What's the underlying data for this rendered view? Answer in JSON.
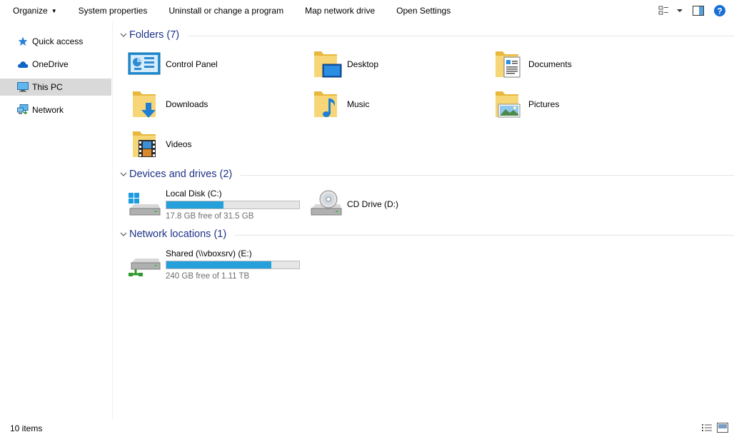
{
  "toolbar": {
    "organize": "Organize",
    "system_properties": "System properties",
    "uninstall": "Uninstall or change a program",
    "map_drive": "Map network drive",
    "open_settings": "Open Settings"
  },
  "nav": {
    "items": [
      {
        "label": "Quick access",
        "icon": "star-icon"
      },
      {
        "label": "OneDrive",
        "icon": "cloud-icon"
      },
      {
        "label": "This PC",
        "icon": "computer-icon",
        "selected": true
      },
      {
        "label": "Network",
        "icon": "network-icon"
      }
    ]
  },
  "groups": {
    "folders": {
      "title": "Folders (7)",
      "items": [
        {
          "label": "Control Panel",
          "icon": "control-panel-icon"
        },
        {
          "label": "Desktop",
          "icon": "desktop-folder-icon"
        },
        {
          "label": "Documents",
          "icon": "documents-folder-icon"
        },
        {
          "label": "Downloads",
          "icon": "downloads-folder-icon"
        },
        {
          "label": "Music",
          "icon": "music-folder-icon"
        },
        {
          "label": "Pictures",
          "icon": "pictures-folder-icon"
        },
        {
          "label": "Videos",
          "icon": "videos-folder-icon"
        }
      ]
    },
    "devices": {
      "title": "Devices and drives (2)",
      "items": [
        {
          "label": "Local Disk (C:)",
          "free": "17.8 GB free of 31.5 GB",
          "used_fraction": 0.43,
          "icon": "local-disk-icon"
        },
        {
          "label": "CD Drive (D:)",
          "icon": "cd-drive-icon"
        }
      ]
    },
    "network": {
      "title": "Network locations (1)",
      "items": [
        {
          "label": "Shared (\\\\vboxsrv) (E:)",
          "free": "240 GB free of 1.11 TB",
          "used_fraction": 0.79,
          "icon": "network-drive-icon"
        }
      ]
    }
  },
  "status": {
    "count": "10 items"
  },
  "colors": {
    "accent": "#26a0da",
    "group_title": "#1e3287",
    "selected_bg": "#d9d9d9"
  }
}
